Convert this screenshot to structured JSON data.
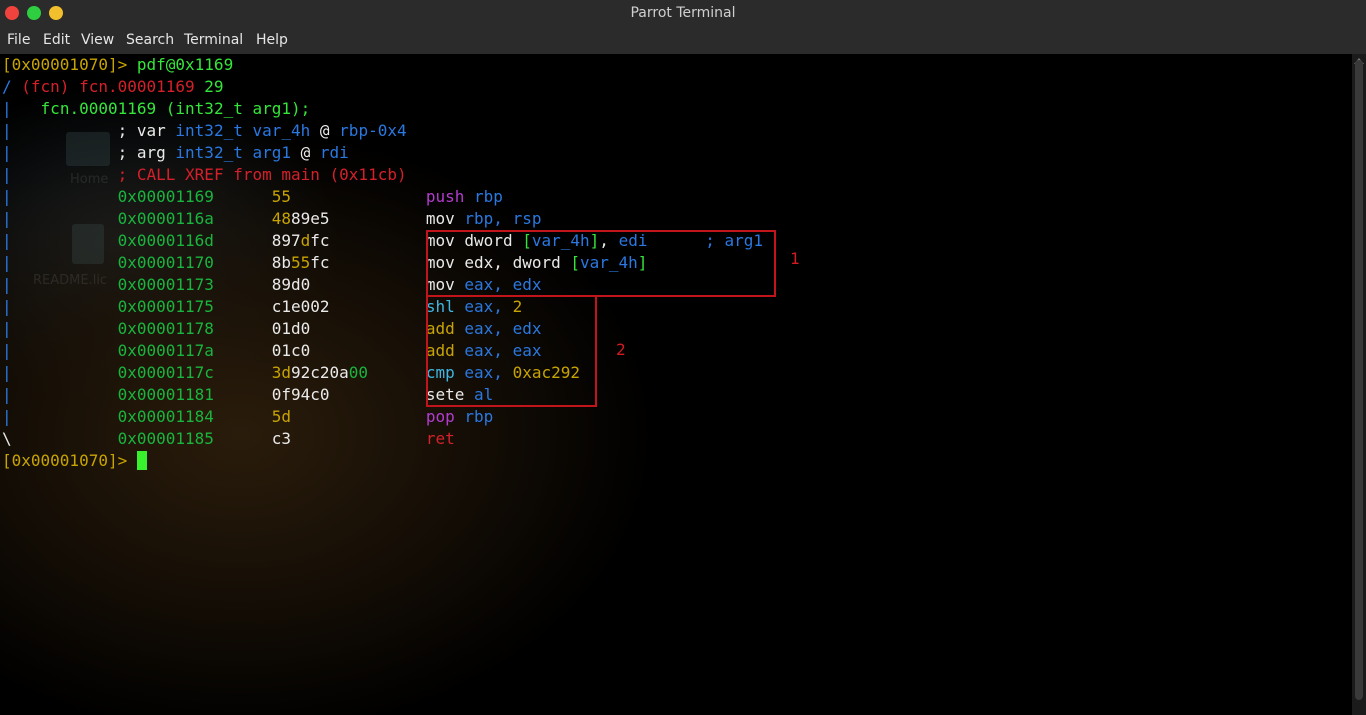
{
  "window": {
    "title": "Parrot Terminal"
  },
  "menu": [
    "File",
    "Edit",
    "View",
    "Search",
    "Terminal",
    "Help"
  ],
  "desktop_ghost": {
    "home_label": "Home",
    "readme_label": "README.lic"
  },
  "terminal": {
    "prompt1": {
      "addr": "[0x00001070]>",
      "cmd": " pdf@0x1169"
    },
    "fcn_header": {
      "open": "/ ",
      "tag": "(fcn) fcn.00001169",
      "size": " 29"
    },
    "signature": "fcn.00001169 (int32_t arg1);",
    "var_line": {
      "semi": "; var ",
      "type": "int32_t var_4h",
      "at": " @ ",
      "loc": "rbp-0x4"
    },
    "arg_line": {
      "semi": "; arg ",
      "type": "int32_t arg1",
      "at": " @ ",
      "loc": "rdi"
    },
    "xref": "; CALL XREF from main (0x11cb)",
    "instructions": [
      {
        "addr": "0x00001169",
        "bytes": "55",
        "m": "push",
        "ops": " rbp"
      },
      {
        "addr": "0x0000116a",
        "bytes": "4889e5",
        "m": "mov",
        "ops": " rbp, rsp"
      },
      {
        "addr": "0x0000116d",
        "bytes": "897dfc",
        "m": "mov",
        "ops": " dword [var_4h], edi",
        "comment": "; arg1"
      },
      {
        "addr": "0x00001170",
        "bytes": "8b55fc",
        "m": "mov",
        "ops": " edx, dword [var_4h]"
      },
      {
        "addr": "0x00001173",
        "bytes": "89d0",
        "m": "mov",
        "ops": " eax, edx"
      },
      {
        "addr": "0x00001175",
        "bytes": "c1e002",
        "m": "shl",
        "ops": " eax, 2"
      },
      {
        "addr": "0x00001178",
        "bytes": "01d0",
        "m": "add",
        "ops": " eax, edx"
      },
      {
        "addr": "0x0000117a",
        "bytes": "01c0",
        "m": "add",
        "ops": " eax, eax"
      },
      {
        "addr": "0x0000117c",
        "bytes": "3d92c20a00",
        "m": "cmp",
        "ops": " eax, 0xac292"
      },
      {
        "addr": "0x00001181",
        "bytes": "0f94c0",
        "m": "sete",
        "ops": " al"
      },
      {
        "addr": "0x00001184",
        "bytes": "5d",
        "m": "pop",
        "ops": " rbp"
      },
      {
        "addr": "0x00001185",
        "bytes": "c3",
        "m": "ret",
        "ops": ""
      }
    ],
    "prompt2": {
      "addr": "[0x00001070]>"
    }
  },
  "annotations": {
    "box1_label": "1",
    "box2_label": "2",
    "color": "#c1151b"
  }
}
